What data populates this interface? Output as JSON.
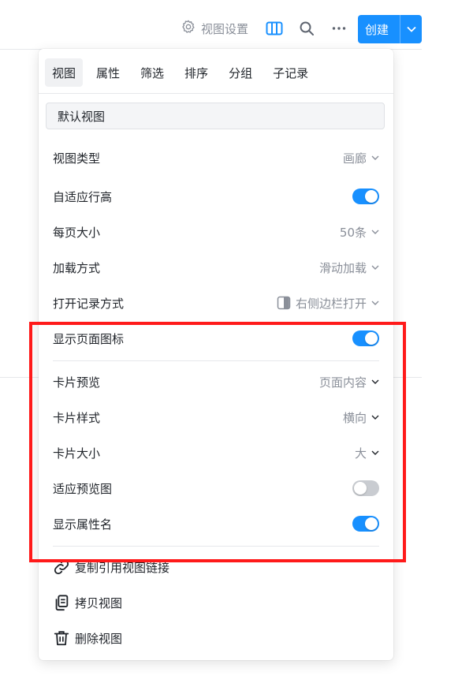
{
  "toolbar": {
    "settings_label": "视图设置",
    "create_label": "创建"
  },
  "tabs": [
    "视图",
    "属性",
    "筛选",
    "排序",
    "分组",
    "子记录"
  ],
  "view_name": "默认视图",
  "settings": {
    "view_type": {
      "label": "视图类型",
      "value": "画廊"
    },
    "auto_row_height": {
      "label": "自适应行高",
      "on": true
    },
    "page_size": {
      "label": "每页大小",
      "value": "50条"
    },
    "load_mode": {
      "label": "加载方式",
      "value": "滑动加载"
    },
    "open_mode": {
      "label": "打开记录方式",
      "value": "右侧边栏打开"
    },
    "show_page_icon": {
      "label": "显示页面图标",
      "on": true
    },
    "card_preview": {
      "label": "卡片预览",
      "value": "页面内容"
    },
    "card_style": {
      "label": "卡片样式",
      "value": "横向"
    },
    "card_size": {
      "label": "卡片大小",
      "value": "大"
    },
    "fit_preview": {
      "label": "适应预览图",
      "on": false
    },
    "show_prop_name": {
      "label": "显示属性名",
      "on": true
    }
  },
  "actions": {
    "copy_link": "复制引用视图链接",
    "duplicate": "拷贝视图",
    "delete": "删除视图"
  },
  "colors": {
    "accent": "#1890ff",
    "highlight": "#ff1a1a"
  }
}
